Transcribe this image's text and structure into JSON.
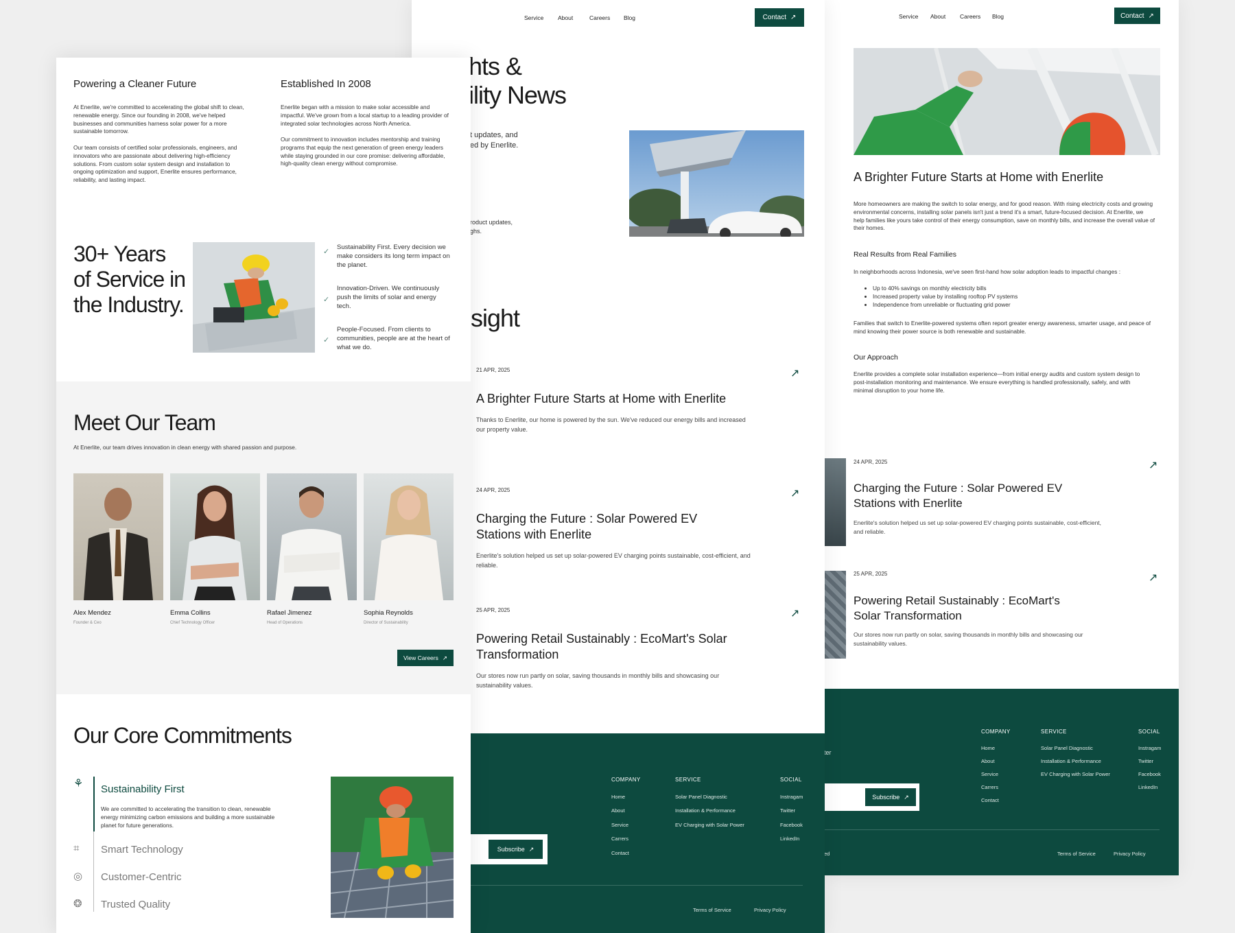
{
  "nav": {
    "service": "Service",
    "about": "About",
    "careers": "Careers",
    "blog": "Blog",
    "contact": "Contact"
  },
  "colors": {
    "brand": "#0d4a3f",
    "background": "#efefef"
  },
  "icons": {
    "arrow": "arrow-up-right-icon",
    "check": "check-icon"
  },
  "about": {
    "col1_title": "Powering a Cleaner Future",
    "col1_p1": "At Enerlite, we're committed to accelerating the global shift to clean, renewable energy. Since our founding in 2008, we've helped businesses and communities harness solar power for a more sustainable tomorrow.",
    "col1_p2": "Our team consists of certified solar professionals, engineers, and innovators who are passionate about delivering high-efficiency solutions. From custom solar system design and installation to ongoing optimization and support, Enerlite ensures performance, reliability, and lasting impact.",
    "col2_title": "Established In 2008",
    "col2_p1": "Enerlite began with a mission to make solar accessible and impactful. We've grown from a local startup to a leading provider of integrated solar technologies across North America.",
    "col2_p2": "Our commitment to innovation includes mentorship and training programs that equip the next generation of green energy leaders while staying grounded in our core promise: delivering affordable, high-quality clean energy without compromise."
  },
  "years": {
    "l1": "30+ Years",
    "l2": "of Service in",
    "l3": "the Industry.",
    "values": [
      "Sustainability First. Every decision we make considers its long term impact on the planet.",
      "Innovation-Driven. We continuously push the limits of solar and energy tech.",
      "People-Focused. From clients to communities, people are at the heart of what we do."
    ]
  },
  "team": {
    "title": "Meet Our Team",
    "subtitle": "At Enerlite, our team drives innovation in clean energy with shared passion and purpose.",
    "members": [
      {
        "name": "Alex Mendez",
        "role": "Founder & Ceo"
      },
      {
        "name": "Emma Collins",
        "role": "Chief Technology Officer"
      },
      {
        "name": "Rafael Jimenez",
        "role": "Head of Operations"
      },
      {
        "name": "Sophia Reynolds",
        "role": "Director of Sustainability"
      }
    ],
    "button": "View Careers"
  },
  "commitments": {
    "title": "Our Core Commitments",
    "items": [
      "Sustainability First",
      "Smart Technology",
      "Customer-Centric",
      "Trusted Quality"
    ],
    "active_desc": "We are committed to accelerating the transition to clean, renewable energy minimizing carbon emissions and building a more sustainable planet for future generations."
  },
  "blog": {
    "hero_l1": "hts &",
    "hero_l2": "ility News",
    "hero_p1a": "t updates, and",
    "hero_p1b": "ed by Enerlite.",
    "hero_p2a": "roduct updates,",
    "hero_p2b": "ghs.",
    "insight": "sight",
    "posts": [
      {
        "date": "21 APR, 2025",
        "title": "A Brighter Future Starts at Home with Enerlite",
        "excerpt": "Thanks to Enerlite, our home is powered by the sun. We've reduced our energy bills and increased our property value."
      },
      {
        "date": "24 APR, 2025",
        "title": "Charging the Future : Solar Powered EV Stations with Enerlite",
        "excerpt": "Enerlite's solution helped us set up solar-powered EV charging points sustainable, cost-efficient, and reliable."
      },
      {
        "date": "25 APR, 2025",
        "title": "Powering Retail Sustainably : EcoMart's Solar Transformation",
        "excerpt": "Our stores now run partly on solar, saving thousands in monthly bills and showcasing our sustainability values."
      }
    ]
  },
  "article": {
    "title": "A Brighter Future Starts at Home with Enerlite",
    "p1": "More homeowners are making the switch to solar energy, and for good reason. With rising electricity costs and growing environmental concerns, installing solar panels isn't just a trend it's a smart, future-focused decision. At Enerlite, we help families like yours take control of their energy consumption, save on monthly bills, and increase the overall value of their homes.",
    "h2": "Real Results from Real Families",
    "p2": "In neighborhoods across Indonesia, we've seen first-hand how solar adoption leads to impactful changes :",
    "bullets": [
      "Up to 40% savings on monthly electricity bills",
      "Increased property value by installing rooftop PV systems",
      "Independence from unreliable or fluctuating grid power"
    ],
    "p3": "Families that switch to Enerlite-powered systems often report greater energy awareness, smarter usage, and peace of mind knowing their power source is both renewable and sustainable.",
    "h3": "Our Approach",
    "p4": "Enerlite provides a complete solar installation experience—from initial energy audits and custom system design to post-installation monitoring and maintenance. We ensure everything is handled professionally, safely, and with minimal disruption to your home life."
  },
  "footer": {
    "company": "COMPANY",
    "service": "SERVICE",
    "social": "SOCIAL",
    "company_items": [
      "Home",
      "About",
      "Service",
      "Carrers",
      "Contact"
    ],
    "service_items": [
      "Solar Panel Diagnostic",
      "Installation & Performance",
      "EV Charging with Solar Power"
    ],
    "social_items": [
      "Instragam",
      "Twitter",
      "Facebook",
      "LinkedIn"
    ],
    "subscribe": "Subscribe",
    "newsletter_frag": "ter",
    "copyright_frag": "ed",
    "terms": "Terms of Service",
    "privacy": "Privacy Policy"
  }
}
